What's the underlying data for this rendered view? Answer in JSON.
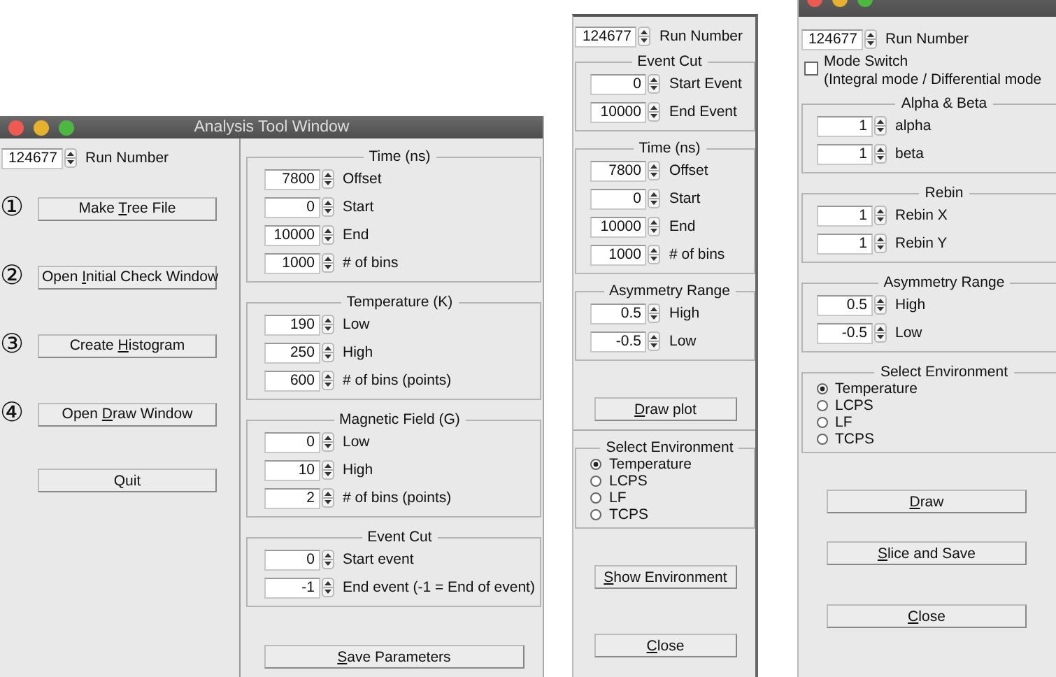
{
  "windows": [
    {
      "kind": "analysis",
      "titlebar": true,
      "title": "Analysis Tool Window",
      "columns": [
        [
          {
            "kind": "spin",
            "value": "124677",
            "label": "Run Number"
          },
          {
            "kind": "button",
            "marker": "①",
            "label_parts": [
              {
                "text": "Make ",
                "underlined": false
              },
              {
                "text": "T",
                "underlined": true
              },
              {
                "text": "ree File",
                "underlined": false
              }
            ]
          },
          {
            "kind": "button",
            "marker": "②",
            "label_parts": [
              {
                "text": "Open ",
                "underlined": false
              },
              {
                "text": "I",
                "underlined": true
              },
              {
                "text": "nitial Check Window",
                "underlined": false
              }
            ]
          },
          {
            "kind": "button",
            "marker": "③",
            "label_parts": [
              {
                "text": "Create ",
                "underlined": false
              },
              {
                "text": "H",
                "underlined": true
              },
              {
                "text": "istogram",
                "underlined": false
              }
            ]
          },
          {
            "kind": "button",
            "marker": "④",
            "label_parts": [
              {
                "text": "Open ",
                "underlined": false
              },
              {
                "text": "D",
                "underlined": true
              },
              {
                "text": "raw Window",
                "underlined": false
              }
            ]
          },
          {
            "kind": "button",
            "label_parts": [
              {
                "text": "Quit",
                "underlined": false
              }
            ]
          }
        ],
        [
          {
            "kind": "group",
            "title": "Time (ns)",
            "fields": [
              {
                "value": "7800",
                "label": "Offset"
              },
              {
                "value": "0",
                "label": "Start"
              },
              {
                "value": "10000",
                "label": "End"
              },
              {
                "value": "1000",
                "label": "# of bins"
              }
            ]
          },
          {
            "kind": "group",
            "title": "Temperature (K)",
            "fields": [
              {
                "value": "190",
                "label": "Low"
              },
              {
                "value": "250",
                "label": "High"
              },
              {
                "value": "600",
                "label": "# of bins (points)"
              }
            ]
          },
          {
            "kind": "group",
            "title": "Magnetic Field (G)",
            "fields": [
              {
                "value": "0",
                "label": "Low"
              },
              {
                "value": "10",
                "label": "High"
              },
              {
                "value": "2",
                "label": "# of bins (points)"
              }
            ]
          },
          {
            "kind": "group",
            "title": "Event Cut",
            "fields": [
              {
                "value": "0",
                "label": "Start event"
              },
              {
                "value": "-1",
                "label": "End event (-1 = End of event)"
              }
            ]
          },
          {
            "kind": "button",
            "label_parts": [
              {
                "text": "S",
                "underlined": true
              },
              {
                "text": "ave Parameters",
                "underlined": false
              }
            ]
          }
        ]
      ]
    },
    {
      "kind": "plot",
      "titlebar": false,
      "columns": [
        [
          {
            "kind": "spin",
            "value": "124677",
            "label": "Run Number"
          },
          {
            "kind": "group",
            "title": "Event Cut",
            "fields": [
              {
                "value": "0",
                "label": "Start Event"
              },
              {
                "value": "10000",
                "label": "End Event"
              }
            ]
          },
          {
            "kind": "group",
            "title": "Time (ns)",
            "fields": [
              {
                "value": "7800",
                "label": "Offset"
              },
              {
                "value": "0",
                "label": "Start"
              },
              {
                "value": "10000",
                "label": "End"
              },
              {
                "value": "1000",
                "label": "# of bins"
              }
            ]
          },
          {
            "kind": "group",
            "title": "Asymmetry Range",
            "fields": [
              {
                "value": "0.5",
                "label": "High"
              },
              {
                "value": "-0.5",
                "label": "Low"
              }
            ]
          },
          {
            "kind": "button",
            "label_parts": [
              {
                "text": "D",
                "underlined": true
              },
              {
                "text": "raw plot",
                "underlined": false
              }
            ]
          },
          {
            "kind": "separator"
          },
          {
            "kind": "radio_group",
            "title": "Select Environment",
            "options": [
              {
                "label": "Temperature",
                "selected": true
              },
              {
                "label": "LCPS",
                "selected": false
              },
              {
                "label": "LF",
                "selected": false
              },
              {
                "label": "TCPS",
                "selected": false
              }
            ]
          },
          {
            "kind": "button",
            "label_parts": [
              {
                "text": "S",
                "underlined": true
              },
              {
                "text": "how Environment",
                "underlined": false
              }
            ]
          },
          {
            "kind": "button",
            "label_parts": [
              {
                "text": "C",
                "underlined": true
              },
              {
                "text": "lose",
                "underlined": false
              }
            ]
          }
        ]
      ]
    },
    {
      "kind": "draw",
      "titlebar": true,
      "columns": [
        [
          {
            "kind": "spin",
            "value": "124677",
            "label": "Run Number"
          },
          {
            "kind": "checkbox",
            "label": "Mode Switch",
            "note": "(Integral mode / Differential mode",
            "checked": false
          },
          {
            "kind": "group",
            "title": "Alpha & Beta",
            "fields": [
              {
                "value": "1",
                "label": "alpha"
              },
              {
                "value": "1",
                "label": "beta"
              }
            ]
          },
          {
            "kind": "group",
            "title": "Rebin",
            "fields": [
              {
                "value": "1",
                "label": "Rebin X"
              },
              {
                "value": "1",
                "label": "Rebin Y"
              }
            ]
          },
          {
            "kind": "group",
            "title": "Asymmetry Range",
            "fields": [
              {
                "value": "0.5",
                "label": "High"
              },
              {
                "value": "-0.5",
                "label": "Low"
              }
            ]
          },
          {
            "kind": "radio_group",
            "title": "Select Environment",
            "options": [
              {
                "label": "Temperature",
                "selected": true
              },
              {
                "label": "LCPS",
                "selected": false
              },
              {
                "label": "LF",
                "selected": false
              },
              {
                "label": "TCPS",
                "selected": false
              }
            ]
          },
          {
            "kind": "button",
            "label_parts": [
              {
                "text": "D",
                "underlined": true
              },
              {
                "text": "raw",
                "underlined": false
              }
            ]
          },
          {
            "kind": "button",
            "label_parts": [
              {
                "text": "S",
                "underlined": true
              },
              {
                "text": "lice and Save",
                "underlined": false
              }
            ]
          },
          {
            "kind": "button",
            "label_parts": [
              {
                "text": "C",
                "underlined": true
              },
              {
                "text": "lose",
                "underlined": false
              }
            ]
          }
        ]
      ]
    }
  ]
}
